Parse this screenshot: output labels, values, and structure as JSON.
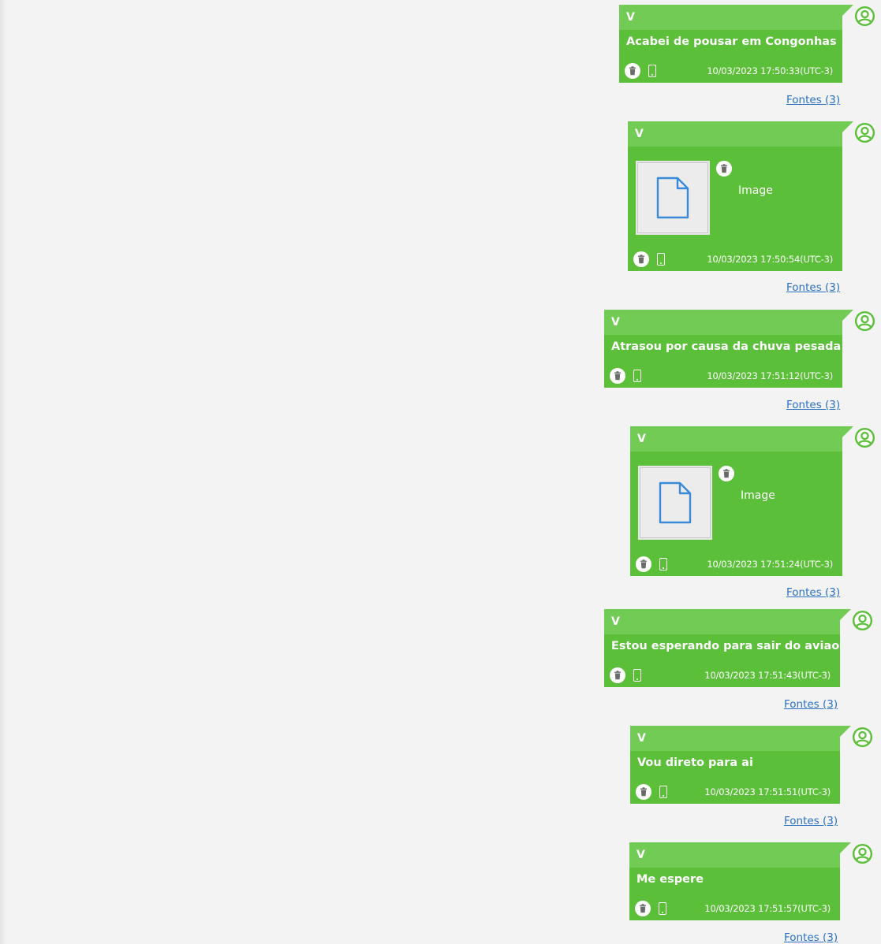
{
  "colors": {
    "bubble": "#5cbf3a",
    "bubble_header": "#72cb54",
    "page_background": "#f3f3f3",
    "link": "#2a6fc4"
  },
  "icons": {
    "avatar": "user-avatar-icon",
    "delete": "trash-icon",
    "device": "phone-icon",
    "attachment": "file-icon"
  },
  "messages": [
    {
      "sender": "V",
      "text": "Acabei de pousar em Congonhas",
      "timestamp": "10/03/2023 17:50:33(UTC-3)",
      "sources": "Fontes (3)"
    },
    {
      "sender": "V",
      "attachment_label": "Image",
      "timestamp": "10/03/2023 17:50:54(UTC-3)",
      "sources": "Fontes (3)"
    },
    {
      "sender": "V",
      "text": "Atrasou por causa da chuva pesada",
      "timestamp": "10/03/2023 17:51:12(UTC-3)",
      "sources": "Fontes (3)"
    },
    {
      "sender": "V",
      "attachment_label": "Image",
      "timestamp": "10/03/2023 17:51:24(UTC-3)",
      "sources": "Fontes (3)"
    },
    {
      "sender": "V",
      "text": "Estou esperando para sair do aviao",
      "timestamp": "10/03/2023 17:51:43(UTC-3)",
      "sources": "Fontes (3)"
    },
    {
      "sender": "V",
      "text": "Vou direto para ai",
      "timestamp": "10/03/2023 17:51:51(UTC-3)",
      "sources": "Fontes (3)"
    },
    {
      "sender": "V",
      "text": "Me espere",
      "timestamp": "10/03/2023 17:51:57(UTC-3)",
      "sources": "Fontes (3)"
    }
  ]
}
